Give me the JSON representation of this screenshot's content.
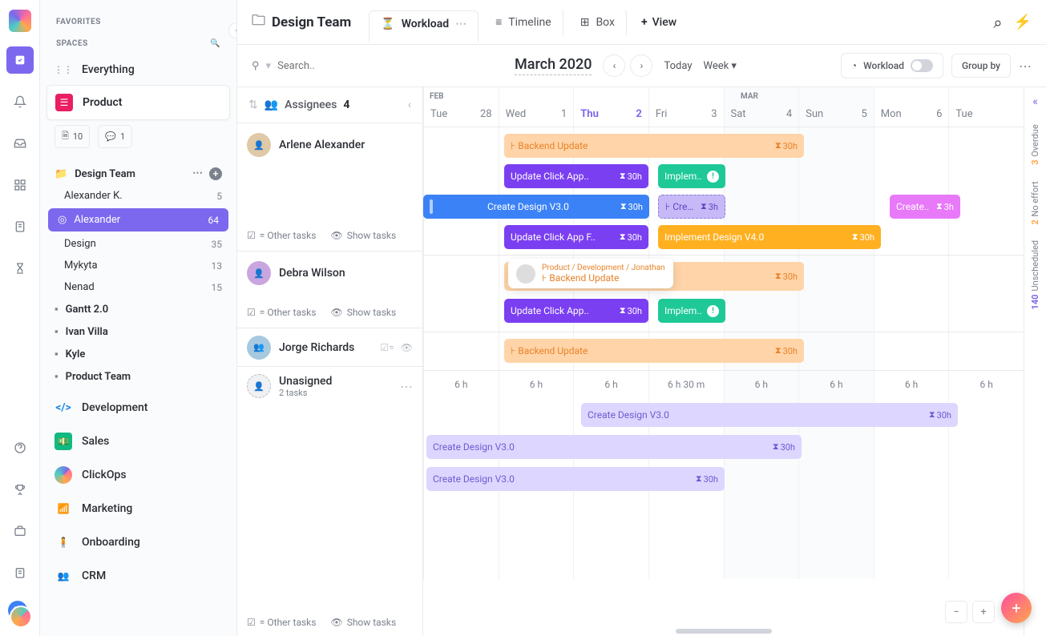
{
  "sidebar": {
    "favorites_label": "FAVORITES",
    "spaces_label": "SPACES",
    "everything": "Everything",
    "active_space": "Product",
    "chips": {
      "docs_count": "10",
      "chat_count": "1"
    },
    "tree": {
      "design_team": "Design Team",
      "items": [
        {
          "label": "Alexander K.",
          "count": "5"
        },
        {
          "label": "Alexander",
          "count": "64",
          "active": true,
          "icon": "👀"
        },
        {
          "label": "Design",
          "count": "35"
        },
        {
          "label": "Mykyta",
          "count": "13"
        },
        {
          "label": "Nenad",
          "count": "15"
        }
      ],
      "folders": [
        "Gantt 2.0",
        "Ivan Villa",
        "Kyle",
        "Product Team"
      ]
    },
    "spaces": [
      {
        "label": "Development",
        "color": "#1e88e5",
        "glyph": "</>"
      },
      {
        "label": "Sales",
        "color": "#10b981",
        "glyph": "$"
      },
      {
        "label": "ClickOps",
        "color": "conic",
        "glyph": ""
      },
      {
        "label": "Marketing",
        "color": "#ef4444",
        "glyph": "📶"
      },
      {
        "label": "Onboarding",
        "color": "#f59e0b",
        "glyph": "🙋"
      },
      {
        "label": "CRM",
        "color": "#3b82f6",
        "glyph": "👥"
      }
    ]
  },
  "header": {
    "title": "Design Team",
    "tabs": [
      {
        "label": "Workload",
        "active": true
      },
      {
        "label": "Timeline"
      },
      {
        "label": "Box"
      }
    ],
    "add_view": "View"
  },
  "toolbar": {
    "search_placeholder": "Search..",
    "month": "March 2020",
    "today": "Today",
    "range": "Week",
    "workload_btn": "Workload",
    "groupby_btn": "Group by"
  },
  "calendar": {
    "months": {
      "feb": "FEB",
      "mar": "MAR"
    },
    "days": [
      {
        "dow": "Tue",
        "num": "28"
      },
      {
        "dow": "Wed",
        "num": "1"
      },
      {
        "dow": "Thu",
        "num": "2",
        "highlight": true
      },
      {
        "dow": "Fri",
        "num": "3"
      },
      {
        "dow": "Sat",
        "num": "4",
        "weekend": true
      },
      {
        "dow": "Sun",
        "num": "5",
        "weekend": true
      },
      {
        "dow": "Mon",
        "num": "6"
      },
      {
        "dow": "Tue",
        "num": ""
      }
    ]
  },
  "assignees": {
    "header": "Assignees",
    "count": "4",
    "other_tasks": "= Other tasks",
    "show_tasks": "Show tasks",
    "people": [
      {
        "name": "Arlene Alexander"
      },
      {
        "name": "Debra Wilson"
      },
      {
        "name": "Jorge Richards"
      },
      {
        "name": "Unasigned",
        "sub": "2 tasks"
      }
    ]
  },
  "bars": {
    "backend_update": "Backend Update",
    "update_click_app": "Update Click App..",
    "update_click_app_f": "Update Click App F..",
    "implement_short": "Implem..",
    "implement_design": "Implement Design V4.0",
    "create_design": "Create Design V3.0",
    "create_short": "Crea..",
    "create_dots": "Create..",
    "h30": "30h",
    "h3": "3h",
    "tooltip_breadcrumb": "Product / Development / Jonathan",
    "tooltip_title": "Backend Update"
  },
  "hours": [
    "6 h",
    "6 h",
    "6 h",
    "6 h 30 m",
    "6 h",
    "6 h",
    "6 h",
    "6 h"
  ],
  "right_rail": {
    "overdue": {
      "num": "3",
      "label": "Overdue"
    },
    "noeffort": {
      "num": "2",
      "label": "No effort"
    },
    "unscheduled": {
      "num": "140",
      "label": "Unscheduled"
    }
  }
}
